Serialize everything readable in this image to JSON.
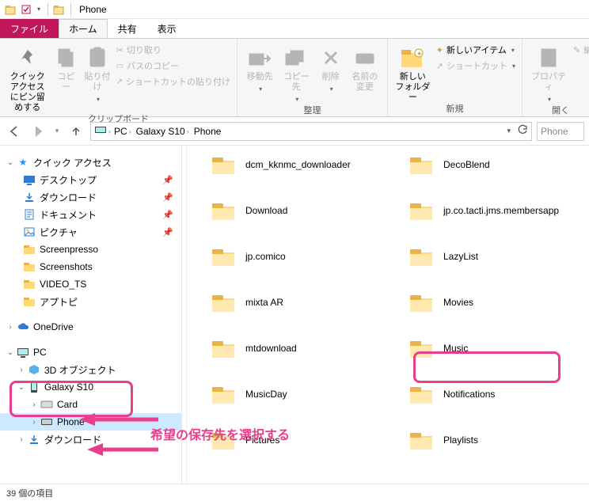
{
  "window": {
    "title": "Phone"
  },
  "tabs": {
    "file": "ファイル",
    "home": "ホーム",
    "share": "共有",
    "view": "表示"
  },
  "ribbon": {
    "clipboard": {
      "caption": "クリップボード",
      "pin": "クイック アクセス\nにピン留めする",
      "copy": "コピ\nー",
      "paste": "貼り付け",
      "cut": "切り取り",
      "copypath": "パスのコピー",
      "pasteshortcut": "ショートカットの貼り付け"
    },
    "organize": {
      "caption": "整理",
      "moveto": "移動先",
      "copyto": "コピー先",
      "delete": "削除",
      "rename": "名前の\n変更"
    },
    "new": {
      "caption": "新規",
      "newfolder": "新しい\nフォルダー",
      "newitem": "新しいアイテム",
      "shortcut": "ショートカット"
    },
    "open": {
      "caption": "開く",
      "properties": "プロパティ",
      "edit": "編"
    }
  },
  "breadcrumb": {
    "pc": "PC",
    "device": "Galaxy S10",
    "loc": "Phone"
  },
  "search_placeholder": "Phone",
  "tree": {
    "quick": "クイック アクセス",
    "desktop": "デスクトップ",
    "downloads": "ダウンロード",
    "documents": "ドキュメント",
    "pictures": "ピクチャ",
    "screenpresso": "Screenpresso",
    "screenshots": "Screenshots",
    "videots": "VIDEO_TS",
    "aputobi": "アプトピ",
    "onedrive": "OneDrive",
    "pc": "PC",
    "obj3d": "3D オブジェクト",
    "galaxy": "Galaxy S10",
    "card": "Card",
    "phone": "Phone",
    "downloads2": "ダウンロード"
  },
  "folders_left": [
    "dcm_kknmc_downloader",
    "Download",
    "jp.comico",
    "mixta AR",
    "mtdownload",
    "MusicDay",
    "Pictures"
  ],
  "folders_right": [
    "DecoBlend",
    "jp.co.tacti.jms.membersapp",
    "LazyList",
    "Movies",
    "Music",
    "Notifications",
    "Playlists"
  ],
  "status": "39 個の項目",
  "annotation_text": "希望の保存先を選択する"
}
